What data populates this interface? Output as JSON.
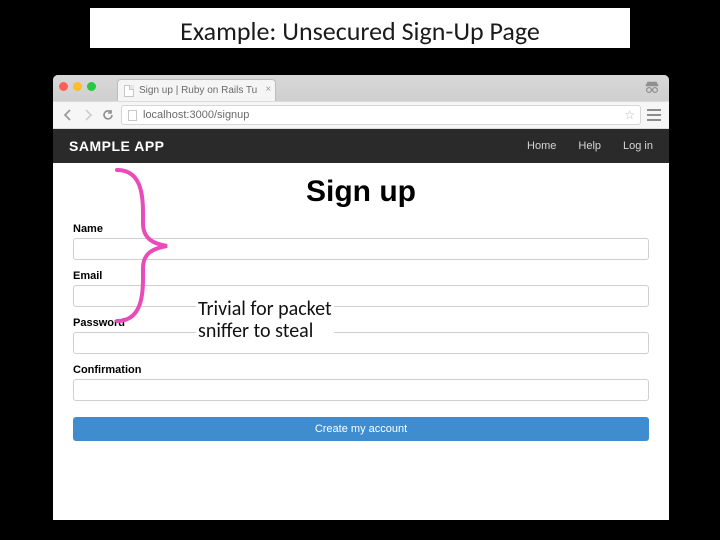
{
  "slide": {
    "title": "Example: Unsecured Sign-Up Page"
  },
  "browser": {
    "tab_title": "Sign up | Ruby on Rails Tu",
    "url": "localhost:3000/signup"
  },
  "app": {
    "brand": "SAMPLE APP",
    "nav": {
      "home": "Home",
      "help": "Help",
      "login": "Log in"
    }
  },
  "form": {
    "heading": "Sign up",
    "fields": {
      "name": {
        "label": "Name",
        "value": ""
      },
      "email": {
        "label": "Email",
        "value": ""
      },
      "password": {
        "label": "Password",
        "value": ""
      },
      "confirmation": {
        "label": "Confirmation",
        "value": ""
      }
    },
    "submit": "Create my account"
  },
  "annotation": {
    "line1": "Trivial for packet",
    "line2": "sniffer to steal"
  }
}
